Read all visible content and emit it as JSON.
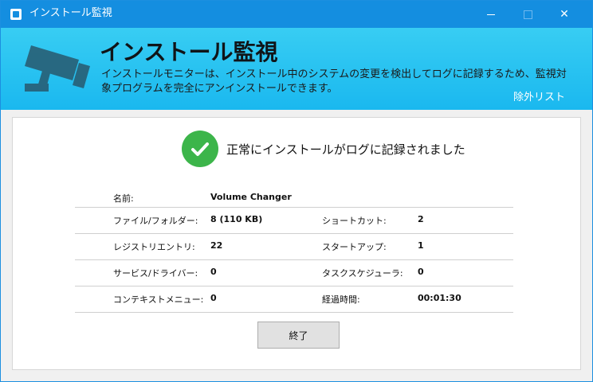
{
  "window": {
    "title": "インストール監視",
    "close_glyph": "✕"
  },
  "header": {
    "title": "インストール監視",
    "description": "インストールモニターは、インストール中のシステムの変更を検出してログに記録するため、監視対象プログラムを完全にアンインストールできます。",
    "exclude_list_label": "除外リスト",
    "accent": "#1ab8ef"
  },
  "status": {
    "message": "正常にインストールがログに記録されました",
    "check_color": "#3cb54a"
  },
  "info": {
    "name_label": "名前:",
    "name_value": "Volume Changer",
    "rows": [
      {
        "label_l": "ファイル/フォルダー:",
        "value_l": "8 (110 KB)",
        "label_r": "ショートカット:",
        "value_r": "2"
      },
      {
        "label_l": "レジストリエントリ:",
        "value_l": "22",
        "label_r": "スタートアップ:",
        "value_r": "1"
      },
      {
        "label_l": "サービス/ドライバー:",
        "value_l": "0",
        "label_r": "タスクスケジューラ:",
        "value_r": "0"
      },
      {
        "label_l": "コンテキストメニュー:",
        "value_l": "0",
        "label_r": "経過時間:",
        "value_r": "00:01:30"
      }
    ]
  },
  "buttons": {
    "finish_label": "終了"
  }
}
